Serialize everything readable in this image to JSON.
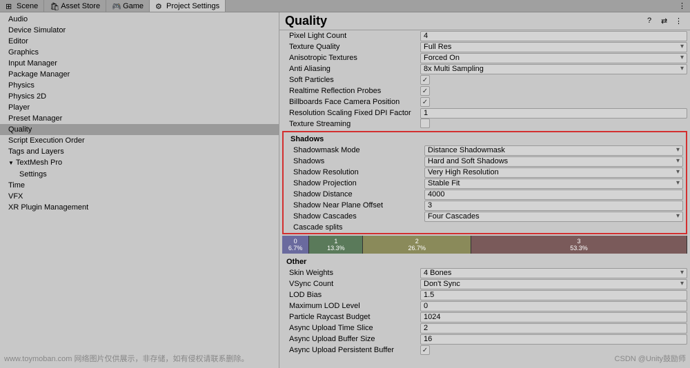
{
  "tabs": [
    {
      "label": "Scene",
      "icon": "scene"
    },
    {
      "label": "Asset Store",
      "icon": "store"
    },
    {
      "label": "Game",
      "icon": "game"
    },
    {
      "label": "Project Settings",
      "icon": "settings",
      "active": true
    }
  ],
  "sidebar": {
    "items": [
      "Audio",
      "Device Simulator",
      "Editor",
      "Graphics",
      "Input Manager",
      "Package Manager",
      "Physics",
      "Physics 2D",
      "Player",
      "Preset Manager",
      "Quality",
      "Script Execution Order",
      "Tags and Layers",
      "TextMesh Pro",
      "Settings",
      "Time",
      "VFX",
      "XR Plugin Management"
    ],
    "selected": "Quality",
    "expandable": "TextMesh Pro",
    "child": "Settings"
  },
  "content": {
    "title": "Quality",
    "rows_top": [
      {
        "label": "Pixel Light Count",
        "type": "input",
        "value": "4"
      },
      {
        "label": "Texture Quality",
        "type": "select",
        "value": "Full Res"
      },
      {
        "label": "Anisotropic Textures",
        "type": "select",
        "value": "Forced On"
      },
      {
        "label": "Anti Aliasing",
        "type": "select",
        "value": "8x Multi Sampling"
      },
      {
        "label": "Soft Particles",
        "type": "check",
        "value": true
      },
      {
        "label": "Realtime Reflection Probes",
        "type": "check",
        "value": true
      },
      {
        "label": "Billboards Face Camera Position",
        "type": "check",
        "value": true
      },
      {
        "label": "Resolution Scaling Fixed DPI Factor",
        "type": "input",
        "value": "1"
      },
      {
        "label": "Texture Streaming",
        "type": "check",
        "value": false
      }
    ],
    "shadows_header": "Shadows",
    "rows_shadows": [
      {
        "label": "Shadowmask Mode",
        "type": "select",
        "value": "Distance Shadowmask"
      },
      {
        "label": "Shadows",
        "type": "select",
        "value": "Hard and Soft Shadows"
      },
      {
        "label": "Shadow Resolution",
        "type": "select",
        "value": "Very High Resolution"
      },
      {
        "label": "Shadow Projection",
        "type": "select",
        "value": "Stable Fit"
      },
      {
        "label": "Shadow Distance",
        "type": "input",
        "value": "4000"
      },
      {
        "label": "Shadow Near Plane Offset",
        "type": "input",
        "value": "3"
      },
      {
        "label": "Shadow Cascades",
        "type": "select",
        "value": "Four Cascades"
      },
      {
        "label": "Cascade splits",
        "type": "none"
      }
    ],
    "cascade": [
      {
        "idx": "0",
        "pct": "6.7%",
        "w": 6.7
      },
      {
        "idx": "1",
        "pct": "13.3%",
        "w": 13.3
      },
      {
        "idx": "2",
        "pct": "26.7%",
        "w": 26.7
      },
      {
        "idx": "3",
        "pct": "53.3%",
        "w": 53.3
      }
    ],
    "other_header": "Other",
    "rows_other": [
      {
        "label": "Skin Weights",
        "type": "select",
        "value": "4 Bones"
      },
      {
        "label": "VSync Count",
        "type": "select",
        "value": "Don't Sync"
      },
      {
        "label": "LOD Bias",
        "type": "input",
        "value": "1.5"
      },
      {
        "label": "Maximum LOD Level",
        "type": "input",
        "value": "0"
      },
      {
        "label": "Particle Raycast Budget",
        "type": "input",
        "value": "1024"
      },
      {
        "label": "Async Upload Time Slice",
        "type": "input",
        "value": "2"
      },
      {
        "label": "Async Upload Buffer Size",
        "type": "input",
        "value": "16"
      },
      {
        "label": "Async Upload Persistent Buffer",
        "type": "check",
        "value": true
      }
    ]
  },
  "watermarks": {
    "left": "www.toymoban.com 网络图片仅供展示，非存储，如有侵权请联系删除。",
    "right": "CSDN @Unity鼓励师"
  }
}
